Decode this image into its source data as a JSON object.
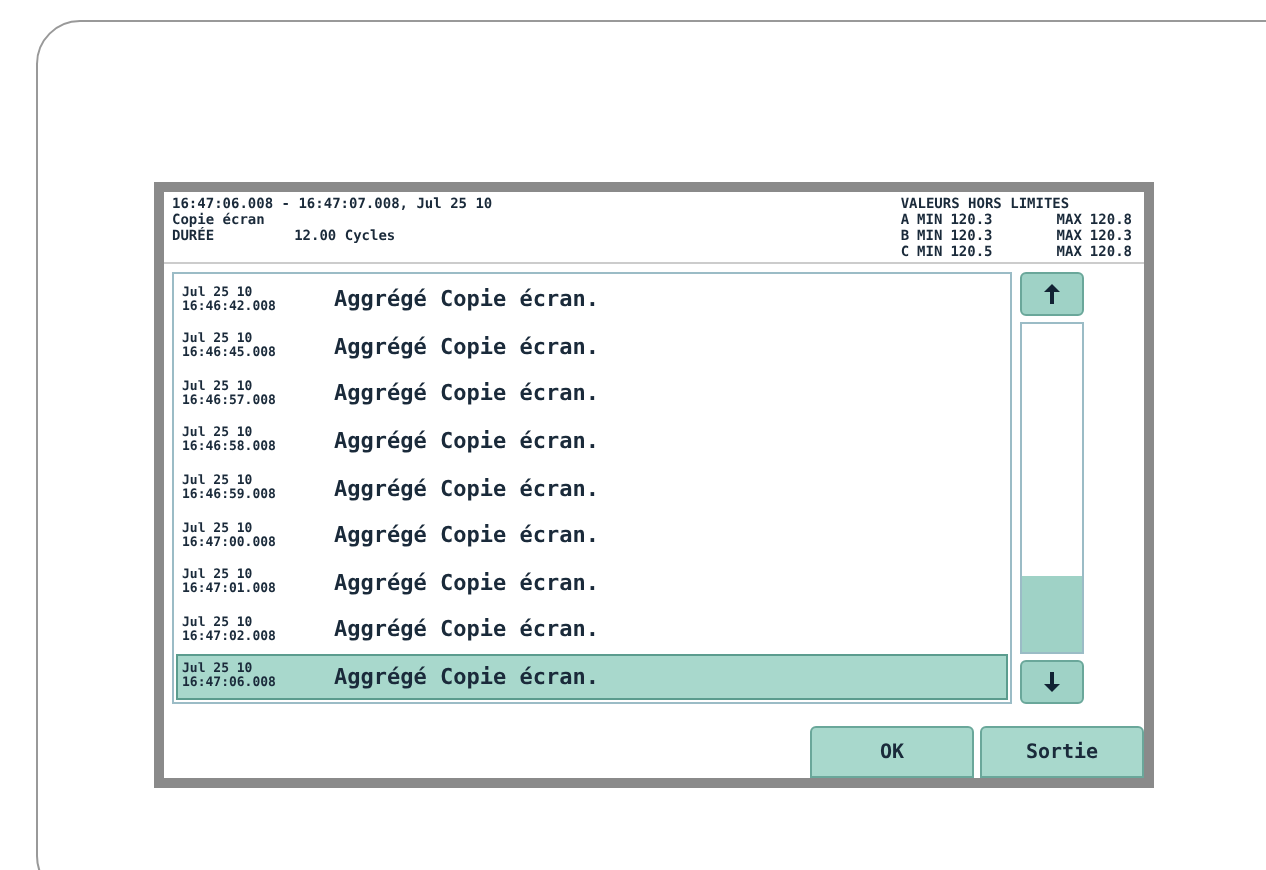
{
  "header": {
    "time_range": "16:47:06.008 - 16:47:07.008, Jul 25 10",
    "mode": "Copie écran",
    "duration_label": "DURÉE",
    "duration_value": "12.00 Cycles",
    "limits_title": "VALEURS HORS LIMITES",
    "limits": [
      {
        "phase": "A",
        "min_label": "MIN",
        "min": "120.3",
        "max_label": "MAX",
        "max": "120.8"
      },
      {
        "phase": "B",
        "min_label": "MIN",
        "min": "120.3",
        "max_label": "MAX",
        "max": "120.3"
      },
      {
        "phase": "C",
        "min_label": "MIN",
        "min": "120.5",
        "max_label": "MAX",
        "max": "120.8"
      }
    ]
  },
  "events": [
    {
      "date": "Jul 25 10",
      "time": "16:46:42.008",
      "event": "Aggrégé Copie écran.",
      "selected": false
    },
    {
      "date": "Jul 25 10",
      "time": "16:46:45.008",
      "event": "Aggrégé Copie écran.",
      "selected": false
    },
    {
      "date": "Jul 25 10",
      "time": "16:46:57.008",
      "event": "Aggrégé Copie écran.",
      "selected": false
    },
    {
      "date": "Jul 25 10",
      "time": "16:46:58.008",
      "event": "Aggrégé Copie écran.",
      "selected": false
    },
    {
      "date": "Jul 25 10",
      "time": "16:46:59.008",
      "event": "Aggrégé Copie écran.",
      "selected": false
    },
    {
      "date": "Jul 25 10",
      "time": "16:47:00.008",
      "event": "Aggrégé Copie écran.",
      "selected": false
    },
    {
      "date": "Jul 25 10",
      "time": "16:47:01.008",
      "event": "Aggrégé Copie écran.",
      "selected": false
    },
    {
      "date": "Jul 25 10",
      "time": "16:47:02.008",
      "event": "Aggrégé Copie écran.",
      "selected": false
    },
    {
      "date": "Jul 25 10",
      "time": "16:47:06.008",
      "event": "Aggrégé Copie écran.",
      "selected": true
    }
  ],
  "buttons": [
    {
      "label": "OK"
    },
    {
      "label": "Sortie"
    }
  ]
}
